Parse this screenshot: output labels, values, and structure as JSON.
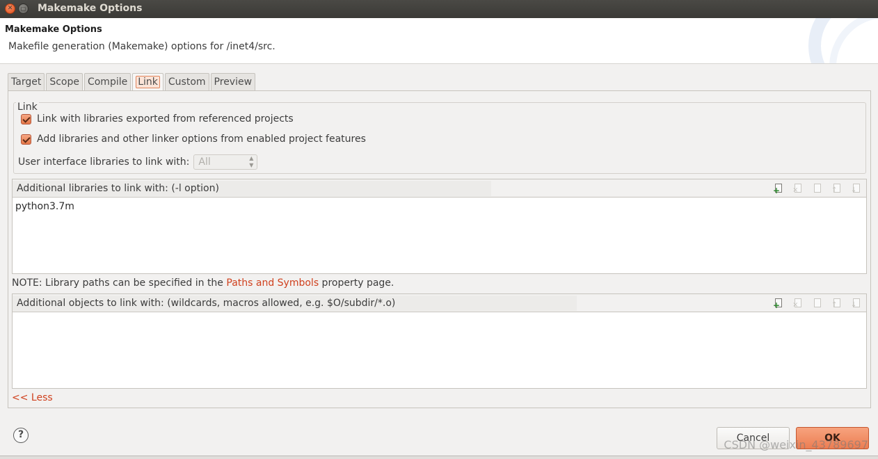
{
  "window": {
    "title": "Makemake Options"
  },
  "header": {
    "title": "Makemake Options",
    "description": "Makefile generation (Makemake) options for /inet4/src."
  },
  "tabs": [
    {
      "label": "Target"
    },
    {
      "label": "Scope"
    },
    {
      "label": "Compile"
    },
    {
      "label": "Link",
      "active": true
    },
    {
      "label": "Custom"
    },
    {
      "label": "Preview"
    }
  ],
  "link_group": {
    "legend": "Link",
    "check1": {
      "label": "Link with libraries exported from referenced projects",
      "checked": true
    },
    "check2": {
      "label": "Add libraries and other linker options from enabled project features",
      "checked": true
    },
    "ui_libs_label": "User interface libraries to link with:",
    "ui_libs_value": "All"
  },
  "libraries_panel": {
    "header": "Additional libraries to link with: (-l option)",
    "items": [
      "python3.7m"
    ]
  },
  "note": {
    "prefix": "NOTE: Library paths can be specified in the ",
    "link": "Paths and Symbols",
    "suffix": " property page."
  },
  "objects_panel": {
    "header": "Additional objects to link with: (wildcards, macros allowed, e.g. $O/subdir/*.o)",
    "items": []
  },
  "less_link": "<< Less",
  "footer": {
    "help_glyph": "?",
    "cancel": "Cancel",
    "ok": "OK"
  },
  "watermark": "CSDN @weixin_43789697",
  "colors": {
    "accent": "#ec7d52",
    "link": "#d0411e"
  }
}
